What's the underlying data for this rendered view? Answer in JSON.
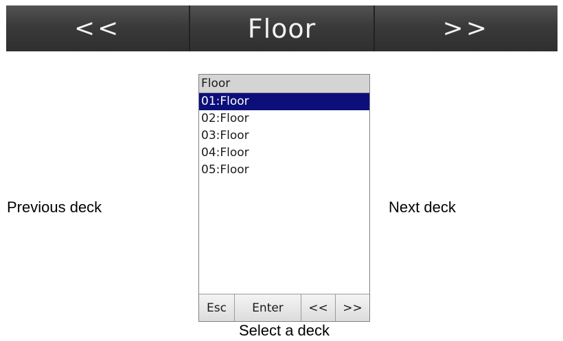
{
  "topbar": {
    "prev_label": "<<",
    "title": "Floor",
    "next_label": ">>"
  },
  "side_labels": {
    "previous": "Previous deck",
    "next": "Next deck"
  },
  "panel": {
    "header": "Floor",
    "items": [
      {
        "label": "01:Floor",
        "selected": true
      },
      {
        "label": "02:Floor",
        "selected": false
      },
      {
        "label": "03:Floor",
        "selected": false
      },
      {
        "label": "04:Floor",
        "selected": false
      },
      {
        "label": "05:Floor",
        "selected": false
      }
    ],
    "buttons": {
      "esc": "Esc",
      "enter": "Enter",
      "prev": "<<",
      "next": ">>"
    }
  },
  "caption": "Select a deck",
  "colors": {
    "selection": "#0c0f7a",
    "header_bg": "#d4d4d4",
    "topbar_bg": "#3c3c3c"
  }
}
